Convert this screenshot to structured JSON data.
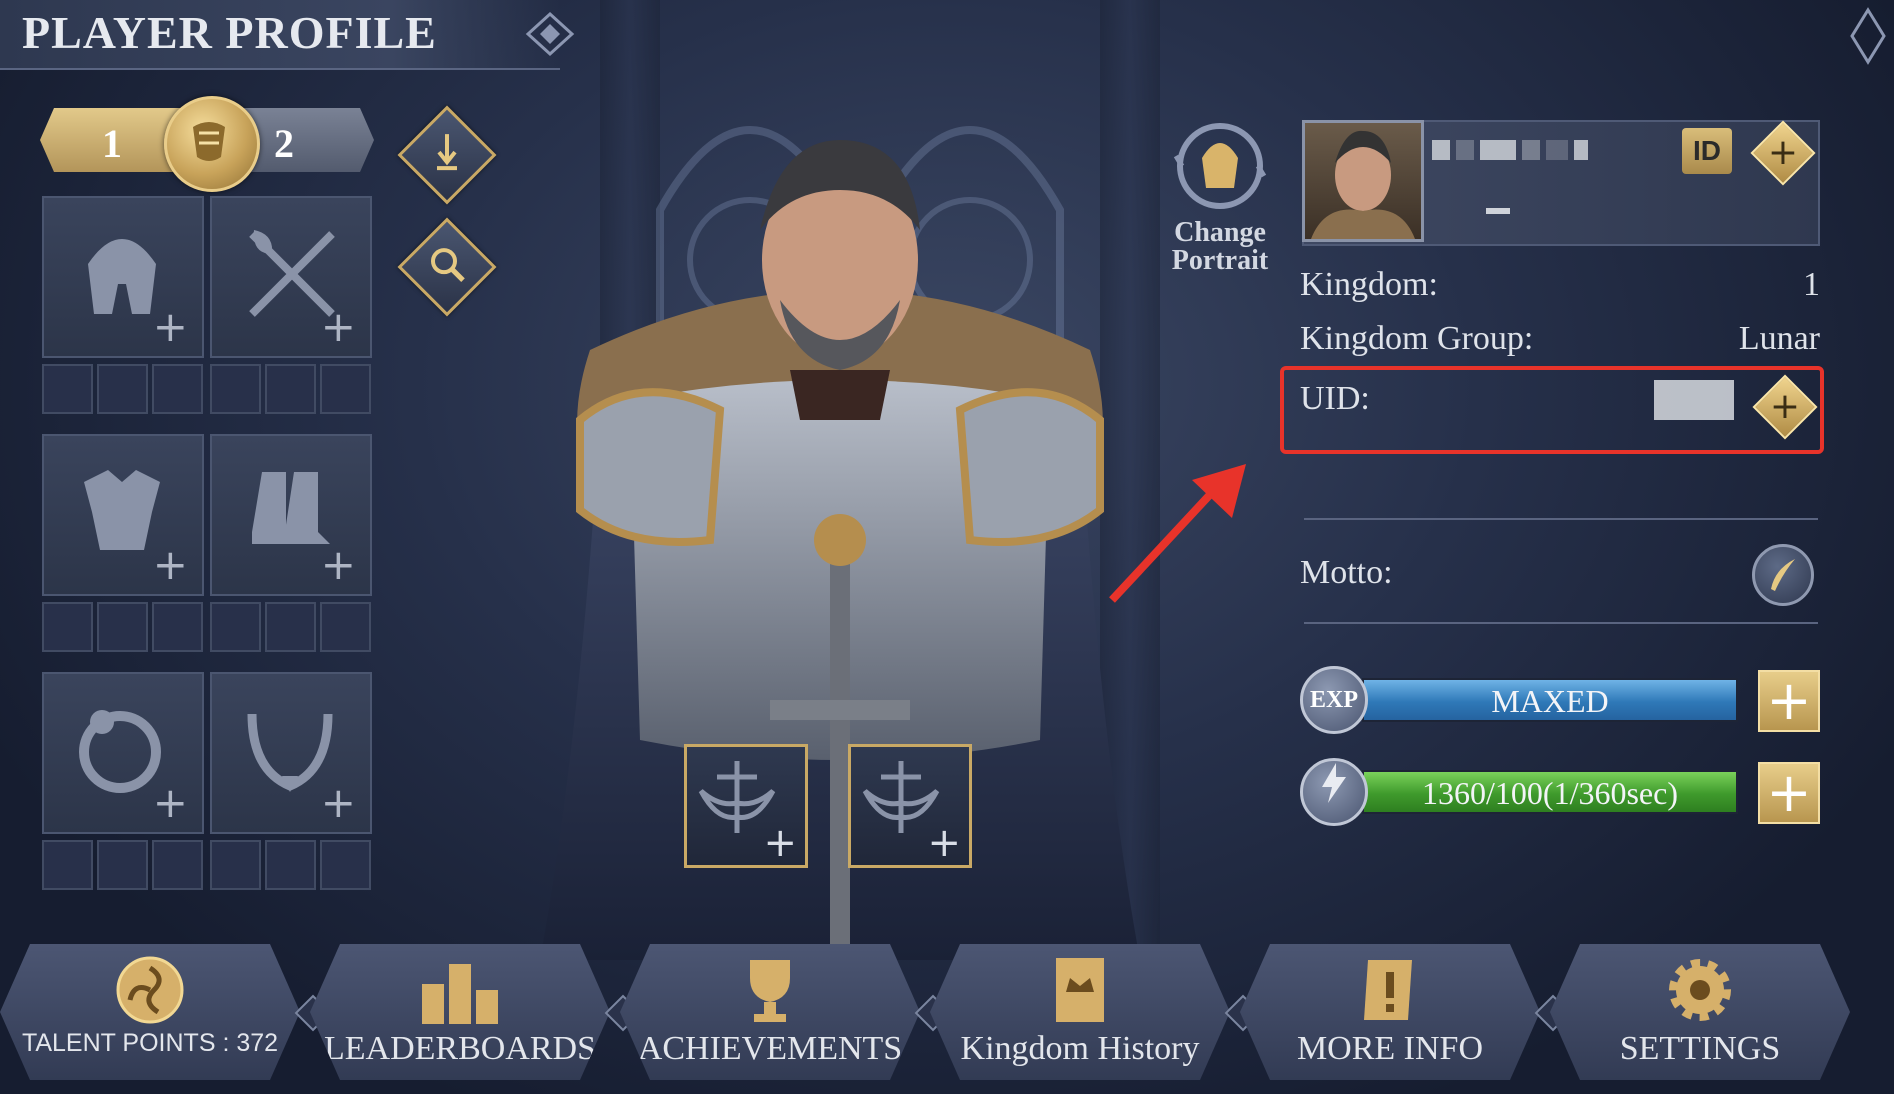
{
  "header": {
    "title": "PLAYER PROFILE"
  },
  "preset": {
    "left_number": "1",
    "right_number": "2"
  },
  "change_portrait": {
    "line1": "Change",
    "line2": "Portrait"
  },
  "profile": {
    "kingdom_label": "Kingdom:",
    "kingdom_value": "1",
    "kingdom_group_label": "Kingdom Group:",
    "kingdom_group_value": "Lunar",
    "uid_label": "UID:",
    "id_badge": "ID",
    "motto_label": "Motto:"
  },
  "bars": {
    "exp_badge": "EXP",
    "exp_text": "MAXED",
    "stamina_text": "1360/100(1/360sec)"
  },
  "nav": {
    "talent_points": "TALENT POINTS : 372",
    "leaderboards": "LEADERBOARDS",
    "achievements": "ACHIEVEMENTS",
    "kingdom_history": "Kingdom History",
    "more_info": "MORE INFO",
    "settings": "SETTINGS"
  },
  "colors": {
    "gold": "#c9a965",
    "highlight_red": "#e8332a",
    "exp_blue": "#2f79b8",
    "stamina_green": "#3f9a2c"
  }
}
